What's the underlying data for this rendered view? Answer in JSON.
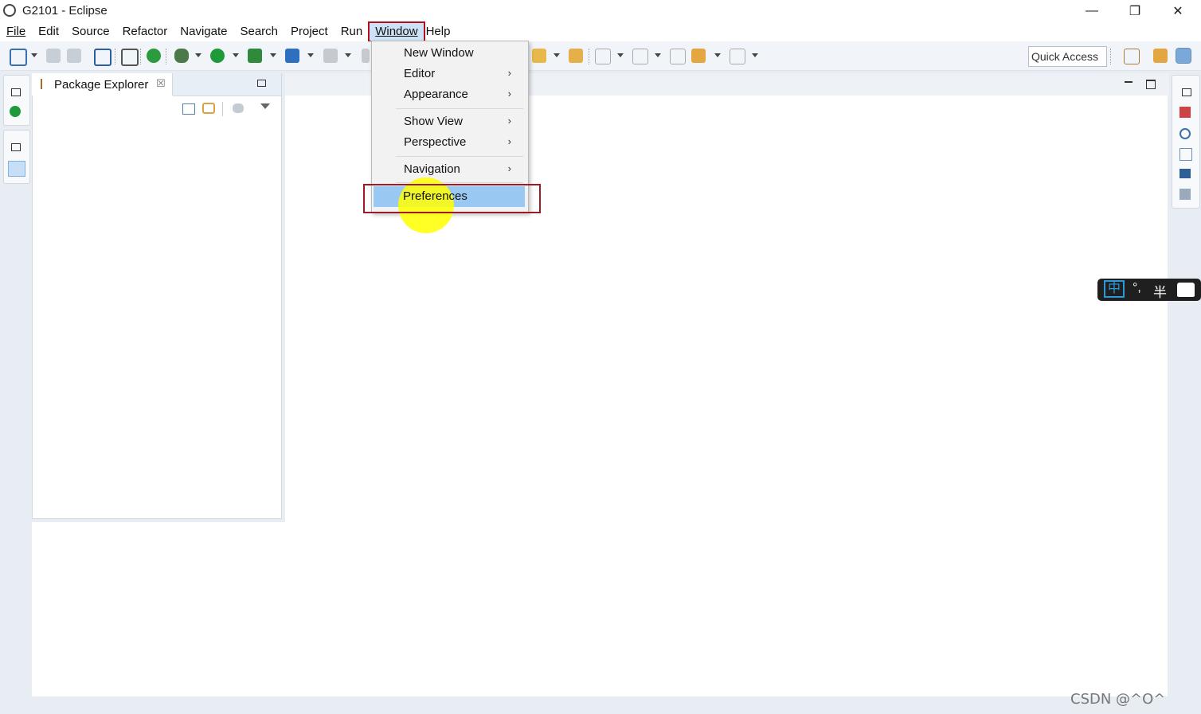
{
  "window": {
    "title": "G2101 - Eclipse",
    "minimize": "—",
    "restore": "❐",
    "close": "✕"
  },
  "menubar": [
    {
      "label": "File"
    },
    {
      "label": "Edit"
    },
    {
      "label": "Source"
    },
    {
      "label": "Refactor"
    },
    {
      "label": "Navigate"
    },
    {
      "label": "Search"
    },
    {
      "label": "Project"
    },
    {
      "label": "Run"
    },
    {
      "label": "Window"
    },
    {
      "label": "Help"
    }
  ],
  "window_menu": {
    "items": [
      {
        "label": "New Window",
        "submenu": false
      },
      {
        "label": "Editor",
        "submenu": true
      },
      {
        "label": "Appearance",
        "submenu": true
      },
      {
        "label": "Show View",
        "submenu": true
      },
      {
        "label": "Perspective",
        "submenu": true
      },
      {
        "label": "Navigation",
        "submenu": true
      },
      {
        "label": "Preferences",
        "submenu": false,
        "highlighted": true
      }
    ],
    "arrow": "›"
  },
  "toolbar": {
    "quick_access": "Quick Access"
  },
  "package_explorer": {
    "title": "Package Explorer",
    "close_glyph": "☒"
  },
  "ime": {
    "mode": "中",
    "punct": "°,",
    "width": "半"
  },
  "watermark": "CSDN @^O^",
  "colors": {
    "highlight": "#99c9f3",
    "annotation_box": "#9c1b27",
    "cursor_halo": "#ffff00"
  }
}
